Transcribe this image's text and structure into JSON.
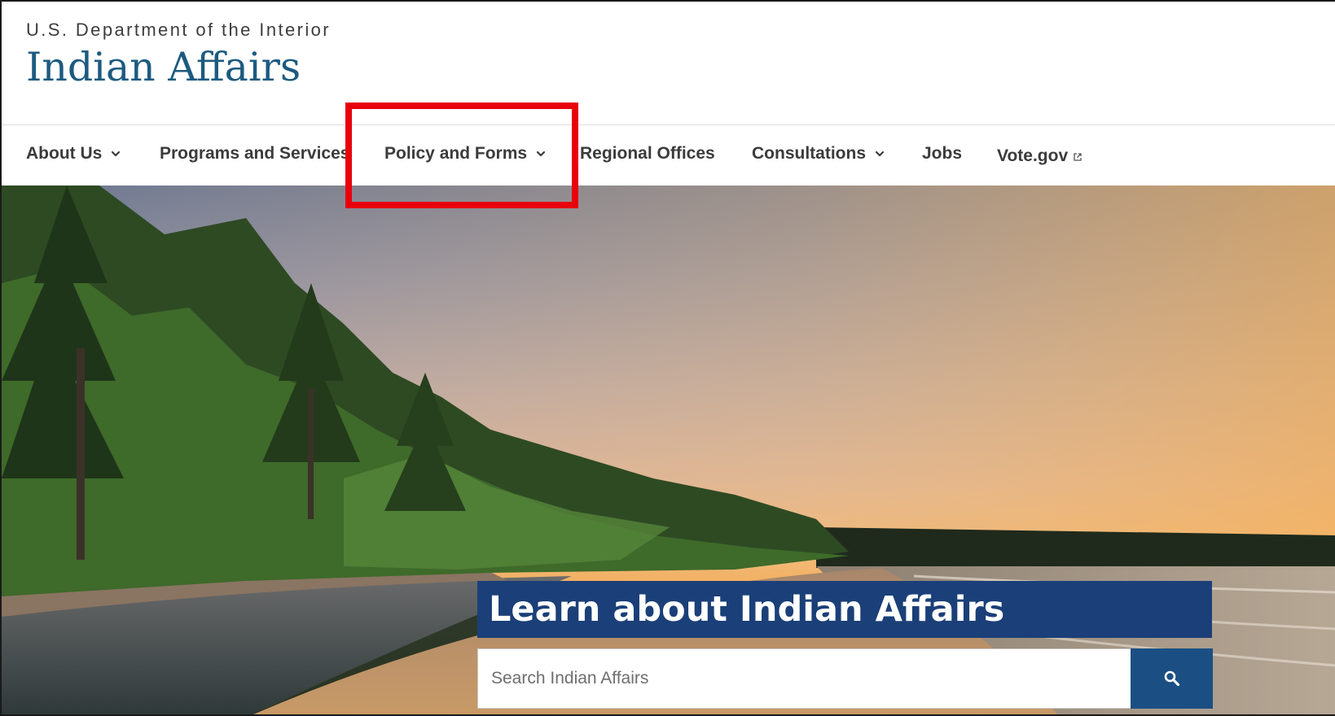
{
  "header": {
    "department": "U.S. Department of the Interior",
    "site_title": "Indian Affairs"
  },
  "nav": {
    "items": [
      {
        "label": "About Us",
        "has_dropdown": true
      },
      {
        "label": "Programs and Services",
        "has_dropdown": false
      },
      {
        "label": "Policy and Forms",
        "has_dropdown": true,
        "highlighted": true
      },
      {
        "label": "Regional Offices",
        "has_dropdown": false
      },
      {
        "label": "Consultations",
        "has_dropdown": true
      },
      {
        "label": "Jobs",
        "has_dropdown": false
      },
      {
        "label": "Vote.gov",
        "has_dropdown": false,
        "external": true
      }
    ]
  },
  "hero": {
    "heading": "Learn about Indian Affairs",
    "search": {
      "placeholder": "Search Indian Affairs",
      "value": ""
    }
  },
  "icons": {
    "dropdown": "chevron-down-icon",
    "external": "external-link-icon",
    "search": "search-icon"
  },
  "colors": {
    "title_blue": "#1d5a80",
    "banner_navy": "#1b3f78",
    "search_button": "#1b4f84",
    "highlight_red": "#e8000d"
  }
}
